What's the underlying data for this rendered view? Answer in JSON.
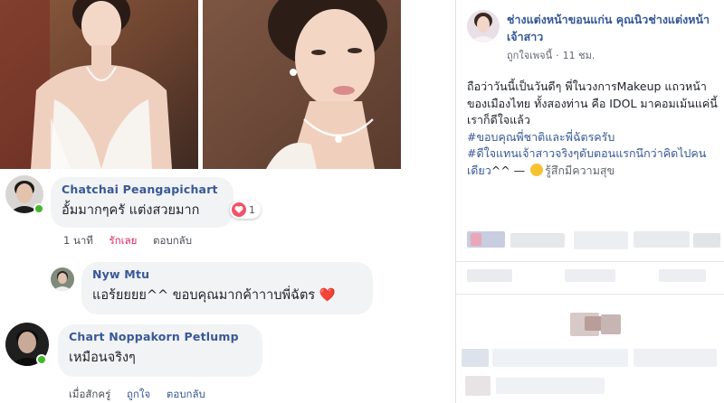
{
  "comments": [
    {
      "author": "Chatchai Peangapichart",
      "text": "อั้มมากๆครั แต่งสวยมาก",
      "reaction_count": "1",
      "actions": {
        "time": "1 นาที",
        "react": "รักเลย",
        "reply": "ตอบกลับ"
      }
    },
    {
      "author": "Nyw Mtu",
      "text": "แอร้ยยยย^^ ขอบคุณมากค้าาาบพี่ฉัตร",
      "emoji": "❤️"
    },
    {
      "author": "Chart Noppakorn Petlump",
      "text": "เหมือนจริงๆ",
      "actions": {
        "time": "เมื่อสักครู่",
        "react": "ถูกใจ",
        "reply": "ตอบกลับ"
      }
    }
  ],
  "post": {
    "page_name": "ช่างแต่งหน้าขอนแก่น คุณนิวช่างแต่งหน้าเจ้าสาว",
    "liked_label": "ถูกใจเพจนี้",
    "time": "11 ชม.",
    "body_line_1": "ถือว่าวันนี้เป็นวันดีๆ พี่ในวงการMakeup แถวหน้าของเมืองไทย ทั้งสองท่าน คือ IDOL มาคอมเม้นแค่นี้เราก็ดีใจแล้ว",
    "hashtag_1": "#ขอบคุณพี่ชาติและพี่ฉัตรครับ",
    "hashtag_2": "#ดีใจแทนเจ้าสาวจริงๆดับตอนแรกนึกว่าคิดไปคนเดียว",
    "body_tail": "^^ —",
    "feeling": "รู้สึกมีความสุข"
  },
  "colors": {
    "link_blue": "#385898",
    "bubble_gray": "#f2f3f5",
    "online_green": "#42b72a",
    "heart_red": "#f25268"
  },
  "icons": [
    "online-dot-icon",
    "love-reaction-icon",
    "heart-emoji-icon",
    "smile-feeling-icon"
  ]
}
